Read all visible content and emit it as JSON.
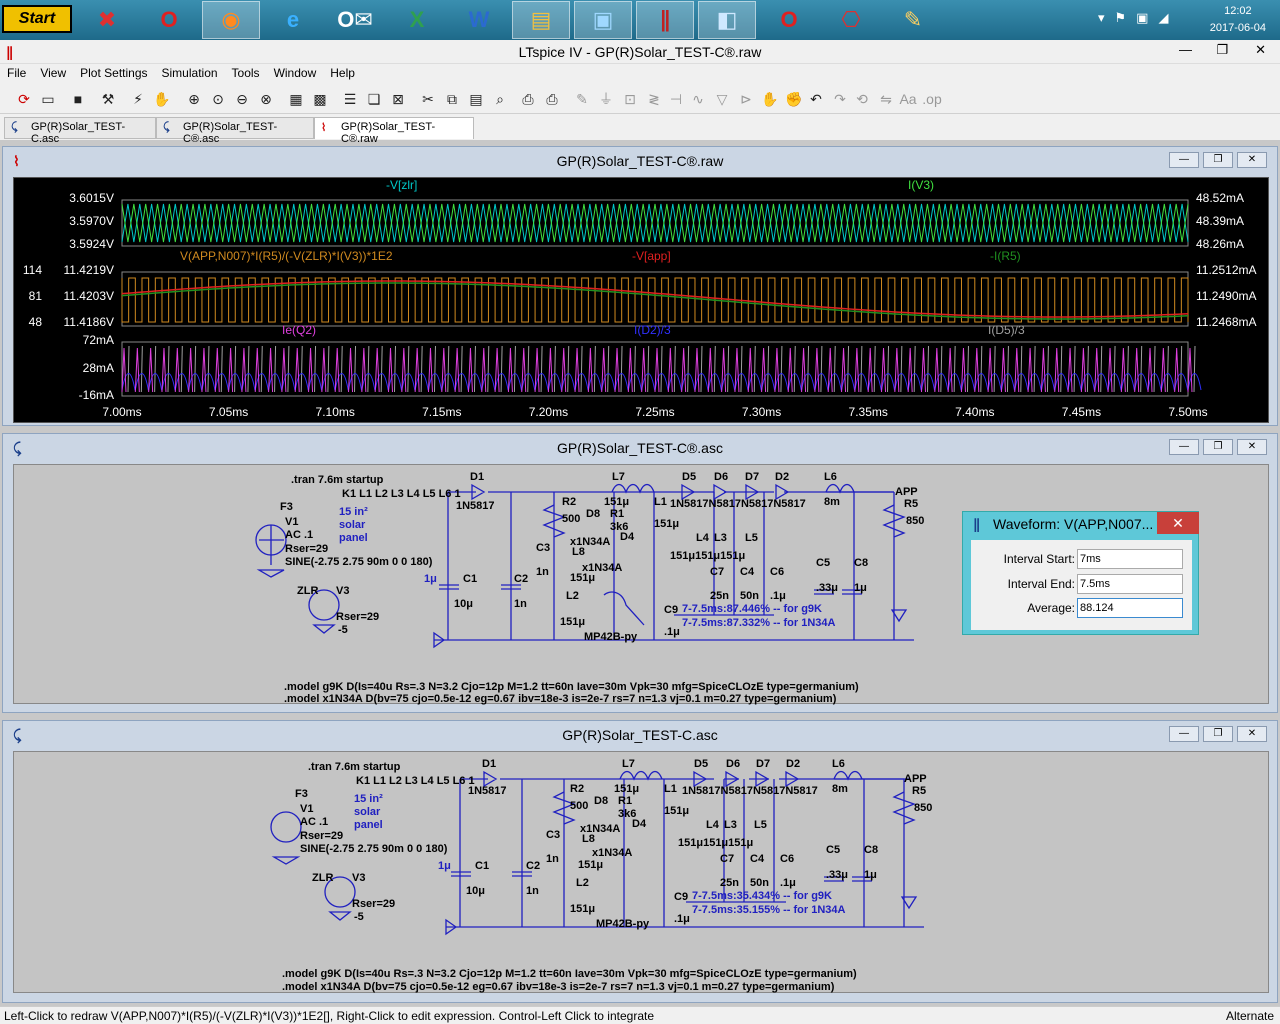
{
  "taskbar": {
    "start_label": "Start",
    "apps": [
      "x-app-icon",
      "opera-icon",
      "firefox-icon",
      "ie-icon",
      "outlook-icon",
      "excel-icon",
      "word-icon",
      "explorer-icon",
      "photos-icon",
      "ltspice-icon",
      "notes-icon",
      "opera-icon-2",
      "pdf-icon",
      "paint-icon"
    ],
    "time": "12:02",
    "date": "2017-06-04"
  },
  "window": {
    "title": "LTspice IV - GP(R)Solar_TEST-C®.raw"
  },
  "menu": [
    "File",
    "View",
    "Plot Settings",
    "Simulation",
    "Tools",
    "Window",
    "Help"
  ],
  "tabs": [
    {
      "label": "GP(R)Solar_TEST-C.asc"
    },
    {
      "label": "GP(R)Solar_TEST-C®.asc"
    },
    {
      "label": "GP(R)Solar_TEST-C®.raw"
    }
  ],
  "plot_window": {
    "title": "GP(R)Solar_TEST-C®.raw",
    "panes": [
      {
        "left_ticks": [
          "3.6015V",
          "3.5970V",
          "3.5924V"
        ],
        "right_ticks": [
          "48.52mA",
          "48.39mA",
          "48.26mA"
        ],
        "traces": [
          {
            "label": "-V[zlr]",
            "color": "#00c8c8"
          },
          {
            "label": "I(V3)",
            "color": "#40e040"
          }
        ]
      },
      {
        "left_ticks": [
          "114",
          "81",
          "48"
        ],
        "left_ticks2": [
          "11.4219V",
          "11.4203V",
          "11.4186V"
        ],
        "right_ticks": [
          "11.2512mA",
          "11.2490mA",
          "11.2468mA"
        ],
        "traces": [
          {
            "label": "V(APP,N007)*I(R5)/(-V(ZLR)*I(V3))*1E2",
            "color": "#d08a20"
          },
          {
            "label": "-V[app]",
            "color": "#e02020"
          },
          {
            "label": "-I(R5)",
            "color": "#209020"
          }
        ]
      },
      {
        "left_ticks": [
          "72mA",
          "28mA",
          "-16mA"
        ],
        "traces": [
          {
            "label": "Ie(Q2)",
            "color": "#e040e0"
          },
          {
            "label": "I(D2)/3",
            "color": "#3030ff"
          },
          {
            "label": "I(D5)/3",
            "color": "#a0a0a0"
          }
        ]
      }
    ],
    "x_ticks": [
      "7.00ms",
      "7.05ms",
      "7.10ms",
      "7.15ms",
      "7.20ms",
      "7.25ms",
      "7.30ms",
      "7.35ms",
      "7.40ms",
      "7.45ms",
      "7.50ms"
    ]
  },
  "schematic1": {
    "title": "GP(R)Solar_TEST-C®.asc",
    "directive": ".tran 7.6m startup",
    "coupling": "K1 L1 L2 L3 L4 L5 L6 1",
    "src_lines": [
      "F3",
      "V1",
      "AC .1",
      "Rser=29",
      "SINE(-2.75 2.75 90m 0 0 180)"
    ],
    "panel_lines": [
      "15 in²",
      "solar",
      "panel"
    ],
    "v3_lines": [
      "ZLR",
      "V3",
      "Rser=29",
      "-5"
    ],
    "res1": [
      "7-7.5ms:87.446% -- for g9K",
      "7-7.5ms:87.332% -- for 1N34A"
    ],
    "models": [
      ".model g9K D(Is=40u Rs=.3 N=3.2 Cjo=12p M=1.2 tt=60n Iave=30m Vpk=30 mfg=SpiceCLOzE type=germanium)",
      ".model x1N34A D(bv=75 cjo=0.5e-12 eg=0.67 ibv=18e-3 is=2e-7 rs=7 n=1.3 vj=0.1 m=0.27 type=germanium)"
    ]
  },
  "schematic2": {
    "title": "GP(R)Solar_TEST-C.asc",
    "res": [
      "7-7.5ms:35.434% -- for g9K",
      "7-7.5ms:35.155% -- for 1N34A"
    ]
  },
  "waveform_dialog": {
    "title": "Waveform: V(APP,N007...",
    "interval_start_label": "Interval Start:",
    "interval_start": "7ms",
    "interval_end_label": "Interval End:",
    "interval_end": "7.5ms",
    "average_label": "Average:",
    "average": "88.124"
  },
  "status": {
    "text": "Left-Click to redraw V(APP,N007)*I(R5)/(-V(ZLR)*I(V3))*1E2[],  Right-Click to edit expression. Control-Left Click to integrate",
    "right": "Alternate"
  }
}
